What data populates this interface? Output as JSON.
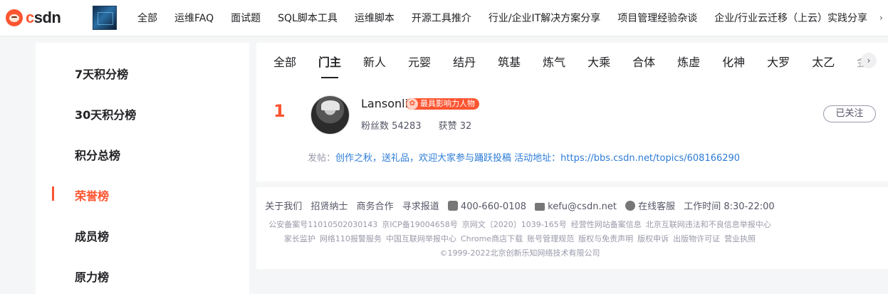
{
  "header": {
    "logo_text": "csdn",
    "nav": [
      "全部",
      "运维FAQ",
      "面试题",
      "SQL脚本工具",
      "运维脚本",
      "开源工具推介",
      "行业/企业IT解决方案分享",
      "项目管理经验杂谈",
      "企业/行业云迁移（上云）实践分享"
    ],
    "more_icon": "chevron-right-icon"
  },
  "sidebar": {
    "items": [
      "7天积分榜",
      "30天积分榜",
      "积分总榜",
      "荣誉榜",
      "成员榜",
      "原力榜"
    ],
    "active_index": 3
  },
  "tabs": {
    "items": [
      "全部",
      "门主",
      "新人",
      "元婴",
      "结丹",
      "筑基",
      "炼气",
      "大乘",
      "合体",
      "炼虚",
      "化神",
      "大罗",
      "太乙",
      "金"
    ],
    "active_index": 1
  },
  "ranking": {
    "rank": "1",
    "username": "Lansonli",
    "badge": "最具影响力人物",
    "fans": "粉丝数 54283",
    "likes": "获赞 32",
    "follow_label": "已关注",
    "post_label": "发帖：",
    "post_text": "创作之秋，送礼品，欢迎大家参与踊跃投稿 活动地址：https://bbs.csdn.net/topics/608166290"
  },
  "footer": {
    "links": [
      "关于我们",
      "招贤纳士",
      "商务合作",
      "寻求报道"
    ],
    "phone": "400-660-0108",
    "email": "kefu@csdn.net",
    "service": "在线客服",
    "hours": "工作时间 8:30-22:00",
    "line2": [
      "公安备案号11010502030143",
      "京ICP备19004658号",
      "京网文〔2020〕1039-165号",
      "经营性网站备案信息",
      "北京互联网违法和不良信息举报中心"
    ],
    "line3": [
      "家长监护",
      "网络110报警服务",
      "中国互联网举报中心",
      "Chrome商店下载",
      "账号管理规范",
      "版权与免责声明",
      "版权申诉",
      "出版物许可证",
      "营业执照"
    ],
    "copyright": "©1999-2022北京创新乐知网络技术有限公司"
  },
  "colors": {
    "accent": "#fc5531",
    "link": "#2d7cd7",
    "page_bg": "#f5f6f7"
  }
}
